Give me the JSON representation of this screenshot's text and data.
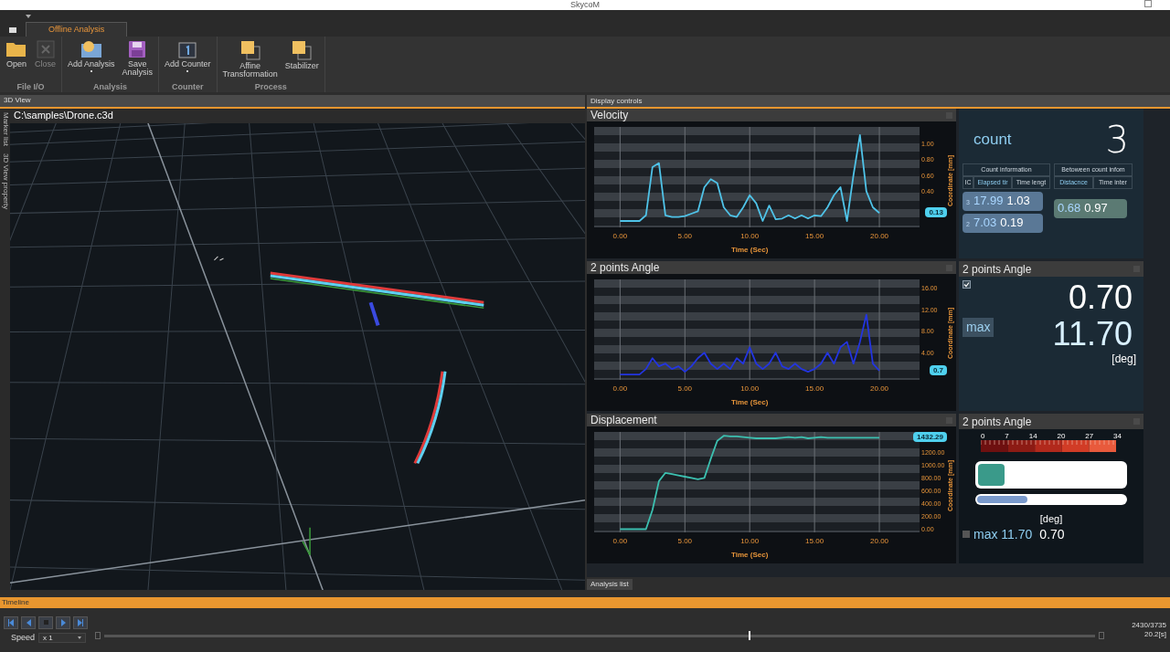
{
  "window": {
    "title": "SkycoM"
  },
  "ribbon": {
    "tabs": [
      {
        "label": "Offline Analysis",
        "selected": true
      }
    ],
    "groups": [
      {
        "label": "File I/O",
        "buttons": [
          {
            "label": "Open",
            "disabled": false
          },
          {
            "label": "Close",
            "disabled": true
          }
        ]
      },
      {
        "label": "Analysis",
        "buttons": [
          {
            "label": "Add Analysis",
            "dropdown": true
          },
          {
            "label": "Save\nAnalysis"
          }
        ]
      },
      {
        "label": "Counter",
        "buttons": [
          {
            "label": "Add Counter",
            "dropdown": true
          }
        ]
      },
      {
        "label": "Process",
        "buttons": [
          {
            "label": "Affine\nTransformation"
          },
          {
            "label": "Stabilizer"
          }
        ]
      }
    ]
  },
  "view3d": {
    "header": "3D View",
    "side_tabs": [
      "Marker list",
      "3D View property"
    ],
    "file_path": "C:\\samples\\Drone.c3d"
  },
  "display": {
    "header": "Display controls",
    "bottom_tab": "Analysis list",
    "charts": [
      {
        "title": "Velocity",
        "current": "0.13",
        "chart_data": {
          "type": "line",
          "grid": true,
          "xlabel": "Time (Sec)",
          "ylabel": "Coordinate [mm]",
          "xlim": [
            -2,
            23.1
          ],
          "ylim": [
            -0.05,
            1.2
          ],
          "xticks": [
            {
              "value": 0,
              "label": "0.00"
            },
            {
              "value": 5,
              "label": "5.00"
            },
            {
              "value": 10,
              "label": "10.00"
            },
            {
              "value": 15,
              "label": "15.00"
            },
            {
              "value": 20,
              "label": "20.00"
            }
          ],
          "yticks": [
            {
              "value": 0.4,
              "label": "0.40"
            },
            {
              "value": 0.6,
              "label": "0.60"
            },
            {
              "value": 0.8,
              "label": "0.80"
            },
            {
              "value": 1,
              "label": "1.00"
            }
          ],
          "x": [
            0,
            0.5,
            1,
            1.5,
            2,
            2.5,
            3,
            3.5,
            4,
            4.5,
            5,
            5.5,
            6,
            6.5,
            7,
            7.5,
            8,
            8.5,
            9,
            9.5,
            10,
            10.5,
            11,
            11.5,
            12,
            12.5,
            13,
            13.5,
            14,
            14.5,
            15,
            15.5,
            16,
            16.5,
            17,
            17.5,
            18,
            18.5,
            19,
            19.5,
            20
          ],
          "series": [
            {
              "color": "#4fc3e8",
              "values": [
                0.03,
                0.03,
                0.03,
                0.03,
                0.1,
                0.7,
                0.75,
                0.1,
                0.08,
                0.08,
                0.09,
                0.12,
                0.15,
                0.45,
                0.55,
                0.5,
                0.2,
                0.1,
                0.08,
                0.2,
                0.35,
                0.25,
                0.03,
                0.22,
                0.05,
                0.06,
                0.1,
                0.06,
                0.1,
                0.06,
                0.1,
                0.09,
                0.2,
                0.35,
                0.45,
                0.03,
                0.6,
                1.1,
                0.4,
                0.2,
                0.13
              ]
            }
          ]
        }
      },
      {
        "title": "2 points Angle",
        "current": "0.7",
        "chart_data": {
          "type": "line",
          "grid": true,
          "xlabel": "Time (Sec)",
          "ylabel": "Coordinate [mm]",
          "xlim": [
            -2,
            23.1
          ],
          "ylim": [
            -1,
            17.5
          ],
          "xticks": [
            {
              "value": 0,
              "label": "0.00"
            },
            {
              "value": 5,
              "label": "5.00"
            },
            {
              "value": 10,
              "label": "10.00"
            },
            {
              "value": 15,
              "label": "15.00"
            },
            {
              "value": 20,
              "label": "20.00"
            }
          ],
          "yticks": [
            {
              "value": 4,
              "label": "4.00"
            },
            {
              "value": 8,
              "label": "8.00"
            },
            {
              "value": 12,
              "label": "12.00"
            },
            {
              "value": 16,
              "label": "16.00"
            }
          ],
          "x": [
            0,
            0.5,
            1,
            1.5,
            2,
            2.5,
            3,
            3.5,
            4,
            4.5,
            5,
            5.5,
            6,
            6.5,
            7,
            7.5,
            8,
            8.5,
            9,
            9.5,
            10,
            10.5,
            11,
            11.5,
            12,
            12.5,
            13,
            13.5,
            14,
            14.5,
            15,
            15.5,
            16,
            16.5,
            17,
            17.5,
            18,
            18.5,
            19,
            19.5,
            20
          ],
          "series": [
            {
              "color": "#2335e0",
              "values": [
                0,
                0,
                0,
                0,
                1,
                3,
                1.5,
                2,
                1,
                1.5,
                0.5,
                1.5,
                3,
                4,
                2,
                1,
                2,
                1,
                3,
                2,
                5,
                2,
                1,
                2,
                4,
                1.5,
                1,
                2,
                1,
                0.5,
                1,
                2,
                4,
                2,
                5,
                6,
                2,
                6,
                11,
                2,
                0.7
              ]
            }
          ]
        }
      },
      {
        "title": "Displacement",
        "current": "1432.29",
        "chart_data": {
          "type": "line",
          "grid": true,
          "xlabel": "Time (Sec)",
          "ylabel": "Coordinate [mm]",
          "xlim": [
            -2,
            23.1
          ],
          "ylim": [
            -50,
            1520
          ],
          "xticks": [
            {
              "value": 0,
              "label": "0.00"
            },
            {
              "value": 5,
              "label": "5.00"
            },
            {
              "value": 10,
              "label": "10.00"
            },
            {
              "value": 15,
              "label": "15.00"
            },
            {
              "value": 20,
              "label": "20.00"
            }
          ],
          "yticks": [
            {
              "value": 0,
              "label": "0.00"
            },
            {
              "value": 200,
              "label": "200.00"
            },
            {
              "value": 400,
              "label": "400.00"
            },
            {
              "value": 600,
              "label": "600.00"
            },
            {
              "value": 800,
              "label": "800.00"
            },
            {
              "value": 1000,
              "label": "1000.00"
            },
            {
              "value": 1200,
              "label": "1200.00"
            }
          ],
          "x": [
            0,
            0.5,
            1,
            1.5,
            2,
            2.5,
            3,
            3.5,
            4,
            4.5,
            5,
            5.5,
            6,
            6.5,
            7,
            7.5,
            8,
            8.5,
            9,
            9.5,
            10,
            10.5,
            11,
            11.5,
            12,
            12.5,
            13,
            13.5,
            14,
            14.5,
            15,
            15.5,
            16,
            16.5,
            17,
            17.5,
            18,
            18.5,
            19,
            19.5,
            20
          ],
          "series": [
            {
              "color": "#3cc0b0",
              "values": [
                0,
                0,
                0,
                0,
                0,
                300,
                750,
                880,
                860,
                840,
                820,
                800,
                780,
                800,
                1100,
                1380,
                1460,
                1450,
                1450,
                1440,
                1430,
                1420,
                1420,
                1420,
                1420,
                1430,
                1440,
                1430,
                1440,
                1420,
                1430,
                1440,
                1430,
                1430,
                1430,
                1430,
                1430,
                1430,
                1430,
                1430,
                1430
              ]
            }
          ]
        }
      }
    ],
    "counter": {
      "label": "count",
      "value": "3",
      "groups": [
        "Count information",
        "Betoween count infom"
      ],
      "columns": [
        "IC",
        "Elapsed tir",
        "Time lengt",
        "Distacnce",
        "Time inter"
      ],
      "rows": [
        {
          "index": "3",
          "elapsed": "17.99",
          "length": "1.03"
        },
        {
          "index": "2",
          "elapsed": "7.03",
          "length": "0.19"
        }
      ],
      "between": [
        {
          "distance": "0.68",
          "interval": "0.97"
        }
      ]
    },
    "angle": {
      "title": "2 points Angle",
      "checked": true,
      "value": "0.70",
      "max_label": "max",
      "max_value": "11.70",
      "unit": "[deg]"
    },
    "gauge": {
      "title": "2 points Angle",
      "scale_labels": [
        "0",
        "7",
        "14",
        "20",
        "27",
        "34"
      ],
      "current_bar": {
        "level": 0.18
      },
      "max_bar": {
        "level": 0.34
      },
      "unit": "[deg]",
      "max_text": "max 11.70",
      "value": "0.70"
    }
  },
  "timeline": {
    "header": "Timeline",
    "buttons": [
      {
        "kind": "first"
      },
      {
        "kind": "previous"
      },
      {
        "kind": "stop"
      },
      {
        "kind": "next"
      },
      {
        "kind": "last"
      }
    ],
    "speed_label": "Speed",
    "speed": "x 1",
    "position": {
      "level": 0.65
    },
    "frame": "2430/3735",
    "time": "20.2[s]"
  }
}
